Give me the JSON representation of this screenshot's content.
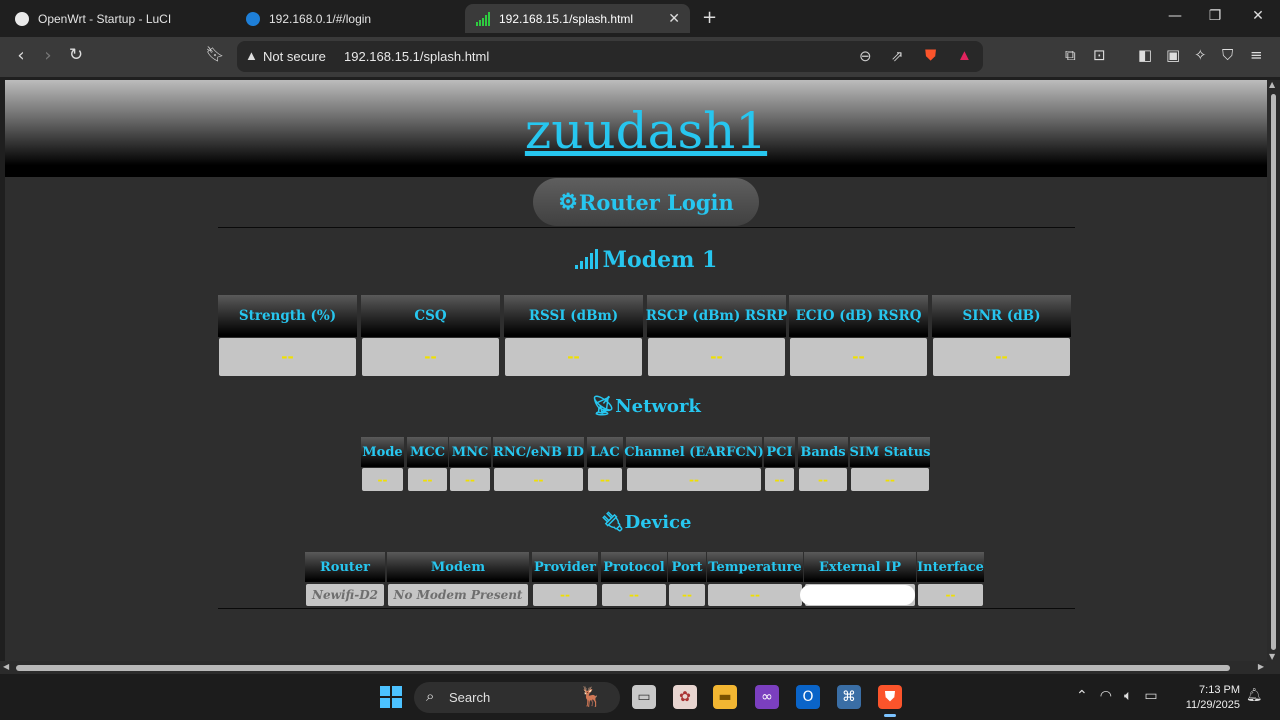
{
  "browser": {
    "tabs": [
      {
        "title": "OpenWrt - Startup - LuCI",
        "active": false
      },
      {
        "title": "192.168.0.1/#/login",
        "active": false
      },
      {
        "title": "192.168.15.1/splash.html",
        "active": true
      }
    ],
    "new_tab": "+",
    "security_label": "Not secure",
    "url": "192.168.15.1/splash.html"
  },
  "page": {
    "site_title": "zuudash1",
    "login_label": "Router Login",
    "modem": {
      "title": "Modem 1",
      "headers": [
        "Strength (%)",
        "CSQ",
        "RSSI (dBm)",
        "RSCP (dBm) RSRP",
        "ECIO (dB) RSRQ",
        "SINR (dB)"
      ],
      "values": [
        "--",
        "--",
        "--",
        "--",
        "--",
        "--"
      ]
    },
    "network": {
      "title": "Network",
      "headers": [
        "Mode",
        "MCC",
        "MNC",
        "RNC/eNB ID",
        "LAC",
        "Channel (EARFCN)",
        "PCI",
        "Bands",
        "SIM Status"
      ],
      "values": [
        "--",
        "--",
        "--",
        "--",
        "--",
        "--",
        "--",
        "--",
        "--"
      ]
    },
    "device": {
      "title": "Device",
      "headers": [
        "Router",
        "Modem",
        "Provider",
        "Protocol",
        "Port",
        "Temperature",
        "External IP",
        "Interface"
      ],
      "values": [
        "Newifi-D2",
        "No Modem Present",
        "--",
        "--",
        "--",
        "--",
        "",
        "--"
      ]
    }
  },
  "taskbar": {
    "search_label": "Search",
    "time": "7:13 PM",
    "date": "11/29/2025"
  },
  "colors": {
    "accent": "#27c6ef",
    "value_yellow": "#f0e000",
    "cell_gray": "#c5c5c5"
  }
}
